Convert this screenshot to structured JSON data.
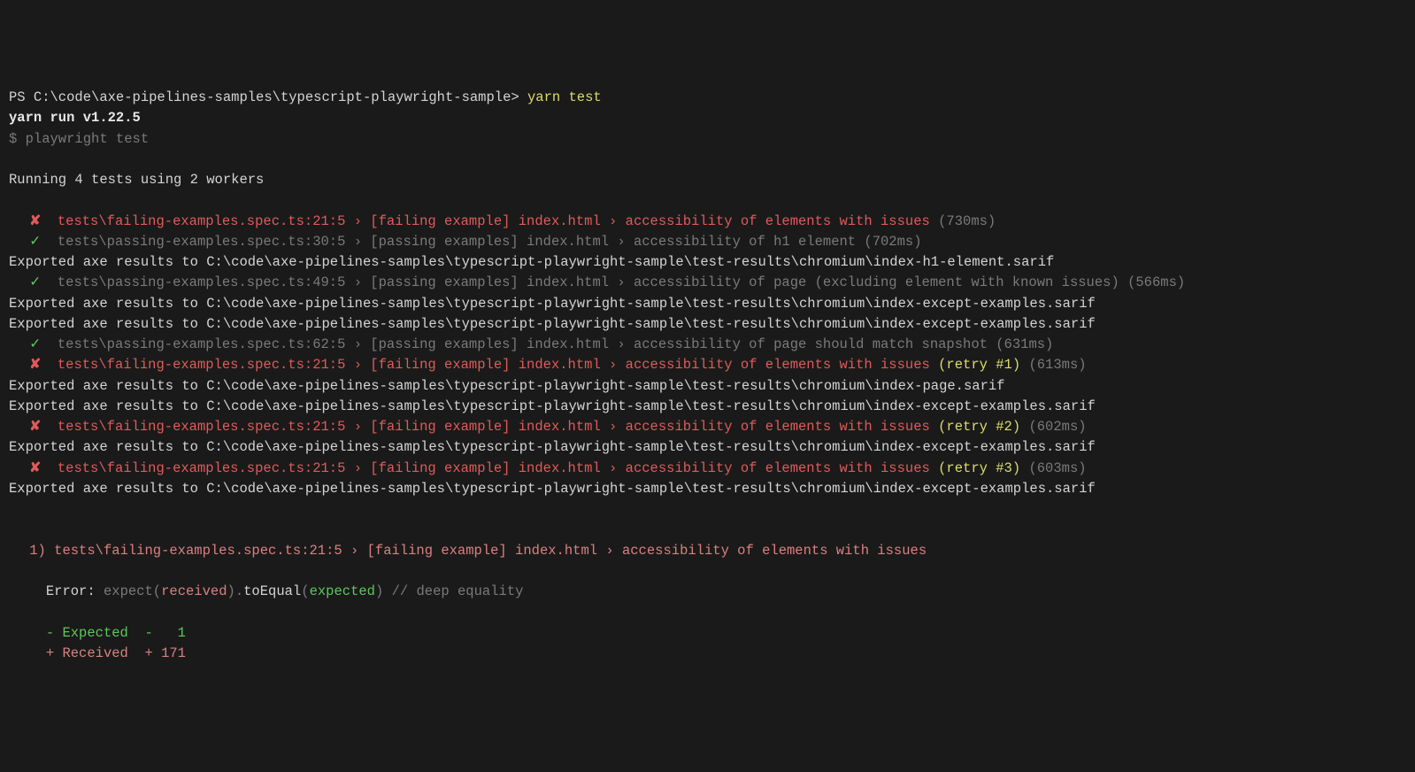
{
  "prompt": {
    "prefix": "PS C:\\code\\axe-pipelines-samples\\typescript-playwright-sample> ",
    "cmd": "yarn test"
  },
  "yarn_line": "yarn run v1.22.5",
  "sub_cmd_prefix": "$ ",
  "sub_cmd": "playwright test",
  "running_line": "Running 4 tests using 2 workers",
  "results": [
    {
      "type": "fail",
      "mark": "✘",
      "path": "tests\\failing-examples.spec.ts:21:5 › [failing example] index.html › accessibility of elements with issues",
      "retry": "",
      "time": "(730ms)"
    },
    {
      "type": "pass",
      "mark": "✓",
      "path": "tests\\passing-examples.spec.ts:30:5 › [passing examples] index.html › accessibility of h1 element",
      "time": "(702ms)"
    },
    {
      "type": "export",
      "text": "Exported axe results to C:\\code\\axe-pipelines-samples\\typescript-playwright-sample\\test-results\\chromium\\index-h1-element.sarif"
    },
    {
      "type": "pass",
      "mark": "✓",
      "path": "tests\\passing-examples.spec.ts:49:5 › [passing examples] index.html › accessibility of page (excluding element with known issues)",
      "time": "(566ms)"
    },
    {
      "type": "export",
      "text": "Exported axe results to C:\\code\\axe-pipelines-samples\\typescript-playwright-sample\\test-results\\chromium\\index-except-examples.sarif"
    },
    {
      "type": "export",
      "text": "Exported axe results to C:\\code\\axe-pipelines-samples\\typescript-playwright-sample\\test-results\\chromium\\index-except-examples.sarif"
    },
    {
      "type": "pass",
      "mark": "✓",
      "path": "tests\\passing-examples.spec.ts:62:5 › [passing examples] index.html › accessibility of page should match snapshot",
      "time": "(631ms)"
    },
    {
      "type": "fail",
      "mark": "✘",
      "path": "tests\\failing-examples.spec.ts:21:5 › [failing example] index.html › accessibility of elements with issues",
      "retry": "(retry #1)",
      "time": "(613ms)"
    },
    {
      "type": "export",
      "text": "Exported axe results to C:\\code\\axe-pipelines-samples\\typescript-playwright-sample\\test-results\\chromium\\index-page.sarif"
    },
    {
      "type": "export",
      "text": "Exported axe results to C:\\code\\axe-pipelines-samples\\typescript-playwright-sample\\test-results\\chromium\\index-except-examples.sarif"
    },
    {
      "type": "fail",
      "mark": "✘",
      "path": "tests\\failing-examples.spec.ts:21:5 › [failing example] index.html › accessibility of elements with issues",
      "retry": "(retry #2)",
      "time": "(602ms)"
    },
    {
      "type": "export",
      "text": "Exported axe results to C:\\code\\axe-pipelines-samples\\typescript-playwright-sample\\test-results\\chromium\\index-except-examples.sarif"
    },
    {
      "type": "fail",
      "mark": "✘",
      "path": "tests\\failing-examples.spec.ts:21:5 › [failing example] index.html › accessibility of elements with issues",
      "retry": "(retry #3)",
      "time": "(603ms)"
    },
    {
      "type": "export",
      "text": "Exported axe results to C:\\code\\axe-pipelines-samples\\typescript-playwright-sample\\test-results\\chromium\\index-except-examples.sarif"
    }
  ],
  "error_header": "1) tests\\failing-examples.spec.ts:21:5 › [failing example] index.html › accessibility of elements with issues",
  "error_line": {
    "prefix": "Error: ",
    "p1": "expect(",
    "received": "received",
    "p2": ").",
    "toEqual": "toEqual",
    "p3": "(",
    "expected": "expected",
    "p4": ")",
    "comment": " // deep equality"
  },
  "diff": {
    "expected": "- Expected  -   1",
    "received": "+ Received  + 171"
  }
}
